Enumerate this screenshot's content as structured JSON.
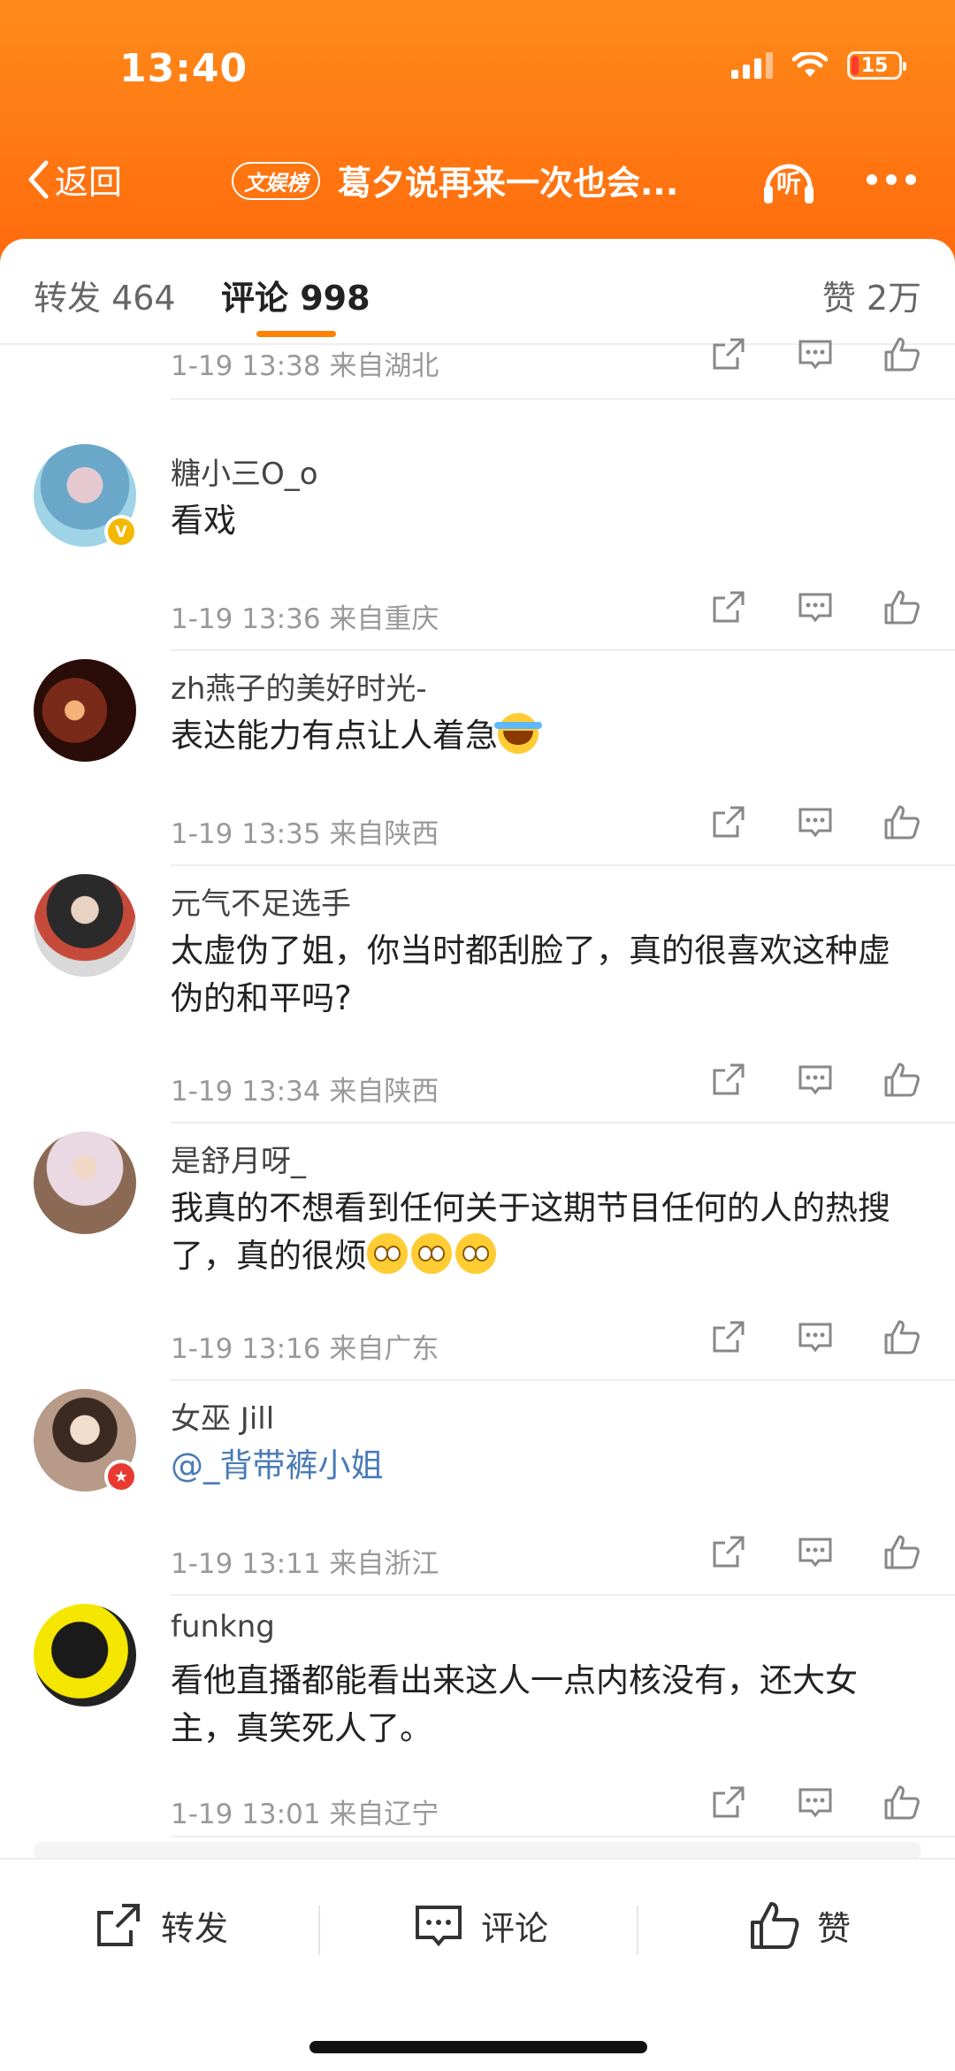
{
  "status": {
    "time": "13:40",
    "battery": "15"
  },
  "nav": {
    "back_label": "返回",
    "tag": "文娱榜",
    "title": "葛夕说再来一次也会...",
    "listen_label": "听"
  },
  "tabs": {
    "repost": "转发 464",
    "comment": "评论 998",
    "like": "赞 2万"
  },
  "colors": {
    "accent": "#ff8200",
    "header": "#ff7a12",
    "mention": "#4a7bb7"
  },
  "partial_meta": "1-19 13:38  来自湖北",
  "comments": [
    {
      "user": "糖小三O_o",
      "text": "看戏",
      "meta": "1-19 13:36  来自重庆",
      "badge": "verified-yellow"
    },
    {
      "user": "zh燕子的美好时光-",
      "text": "表达能力有点让人着急",
      "emoji": "crying-laughing-emoji",
      "meta": "1-19 13:35  来自陕西"
    },
    {
      "user": "元气不足选手",
      "text": "太虚伪了姐，你当时都刮脸了，真的很喜欢这种虚伪的和平吗?",
      "meta": "1-19 13:34  来自陕西"
    },
    {
      "user": "是舒月呀_",
      "text": "我真的不想看到任何关于这期节目任何的人的热搜了，真的很烦",
      "emoji": "pleading-emoji x3",
      "meta": "1-19 13:16  来自广东"
    },
    {
      "user": "女巫 Jill",
      "text": "@_背带裤小姐",
      "meta": "1-19 13:11  来自浙江",
      "badge": "member-red"
    },
    {
      "user": "funkng",
      "text": "看他直播都能看出来这人一点内核没有，还大女主，真笑死人了。",
      "meta": "1-19 13:01  来自辽宁"
    }
  ],
  "bottom": {
    "repost": "转发",
    "comment": "评论",
    "like": "赞"
  }
}
